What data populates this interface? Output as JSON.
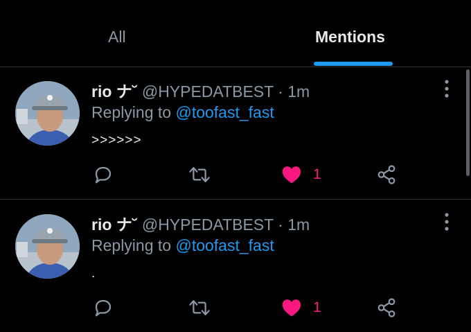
{
  "tabs": [
    {
      "label": "All",
      "selected": false
    },
    {
      "label": "Mentions",
      "selected": true
    }
  ],
  "colors": {
    "accent": "#1d9bf0",
    "like": "#f91880",
    "muted": "#8b98a5"
  },
  "tweets": [
    {
      "name": "rio ナ˘",
      "handle": "@HYPEDATBEST",
      "time": "· 1m",
      "replying_prefix": "Replying to",
      "replying_to": "@toofast_fast",
      "text": ">>>>>>",
      "likes": "1",
      "liked": true
    },
    {
      "name": "rio ナ˘",
      "handle": "@HYPEDATBEST",
      "time": "· 1m",
      "replying_prefix": "Replying to",
      "replying_to": "@toofast_fast",
      "text": ".",
      "likes": "1",
      "liked": true
    }
  ],
  "icons": [
    "reply-icon",
    "retweet-icon",
    "heart-icon",
    "share-icon",
    "more-icon"
  ]
}
